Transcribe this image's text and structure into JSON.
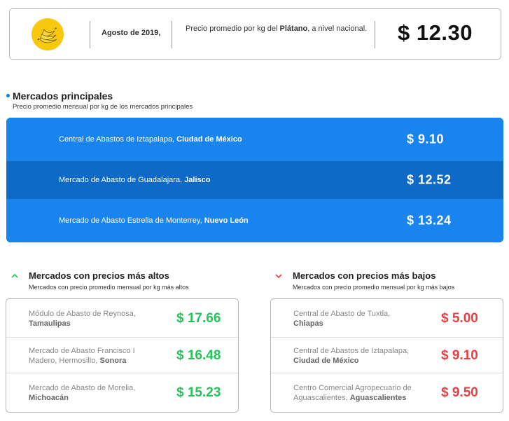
{
  "header": {
    "icon": "banana-icon",
    "date": "Agosto de 2019,",
    "desc_prefix": "Precio promedio por kg del ",
    "desc_product": "Plátano",
    "desc_suffix": ", a nivel nacional.",
    "price": "$ 12.30"
  },
  "main_section": {
    "title": "Mercados principales",
    "subtitle": "Precio promedio mensual por kg de los mercados principales",
    "accent": "#1a84ee",
    "rows": [
      {
        "market": "Central de Abastos de Iztapalapa, ",
        "region": "Ciudad de México",
        "price": "$ 9.10"
      },
      {
        "market": "Mercado de Abasto de Guadalajara, ",
        "region": "Jalisco",
        "price": "$ 12.52"
      },
      {
        "market": "Mercado de Abasto Estrella de Monterrey, ",
        "region": "Nuevo León",
        "price": "$ 13.24"
      }
    ]
  },
  "high_section": {
    "icon": "chevron-up-icon",
    "title": "Mercados con precios más altos",
    "subtitle": "Mercados con precio promedio mensual por kg más altos",
    "color": "#22c45a",
    "rows": [
      {
        "market": "Módulo de Abasto de Reynosa, ",
        "region": "Tamaulipas",
        "price": "$ 17.66"
      },
      {
        "market": "Mercado de Abasto Francisco I Madero, Hermosillo, ",
        "region": "Sonora",
        "price": "$ 16.48"
      },
      {
        "market": "Mercado de Abasto de Morelia, ",
        "region": "Michoacán",
        "price": "$ 15.23"
      }
    ]
  },
  "low_section": {
    "icon": "chevron-down-icon",
    "title": "Mercados con precios más bajos",
    "subtitle": "Mercados con precio promedio mensual por kg más bajos",
    "color": "#ee3d3d",
    "rows": [
      {
        "market": "Central de Abasto de Tuxtla, ",
        "region": "Chiapas",
        "price": "$ 5.00"
      },
      {
        "market": "Central de Abastos de Iztapalapa, ",
        "region": "Ciudad de México",
        "price": "$ 9.10"
      },
      {
        "market": "Centro Comercial Agropecuario de Aguascalientes, ",
        "region": "Aguascalientes",
        "price": "$ 9.50"
      }
    ]
  }
}
